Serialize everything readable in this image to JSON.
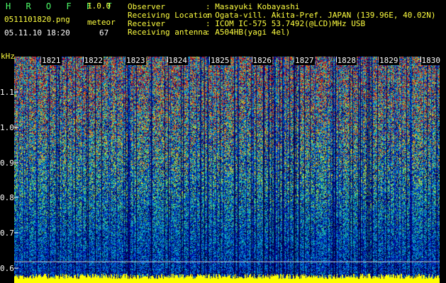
{
  "header": {
    "app_title": "H R O F F T",
    "app_version": "1.0.0",
    "file_name": "0511101820.png",
    "meteor_label": "meteor",
    "meteor_count": "67",
    "date_time": "05.11.10 18:20",
    "fields": [
      {
        "label": "Observer",
        "value": ": Masayuki Kobayashi"
      },
      {
        "label": "Receiving Location",
        "value": ": Ogata-vill. Akita-Pref. JAPAN (139.96E, 40.02N)"
      },
      {
        "label": "Receiver",
        "value": ": ICOM IC-575 53.7492(@LCD)MHz USB"
      },
      {
        "label": "Receiving antenna",
        "value": ": A504HB(yagi 4el)"
      }
    ]
  },
  "axes": {
    "y_unit": "kHz",
    "y_ticks": [
      "1.1",
      "1.0",
      "0.9",
      "0.8",
      "0.7",
      "0.6"
    ],
    "x_ticks": [
      "1821",
      "1822",
      "1823",
      "1824",
      "1825",
      "1826",
      "1827",
      "1828",
      "1829",
      "1830"
    ]
  },
  "colors": {
    "background": "#000000",
    "header_green": "#4dff6a",
    "header_yellow": "#ffff40",
    "baseline_yellow": "#ffff00"
  }
}
